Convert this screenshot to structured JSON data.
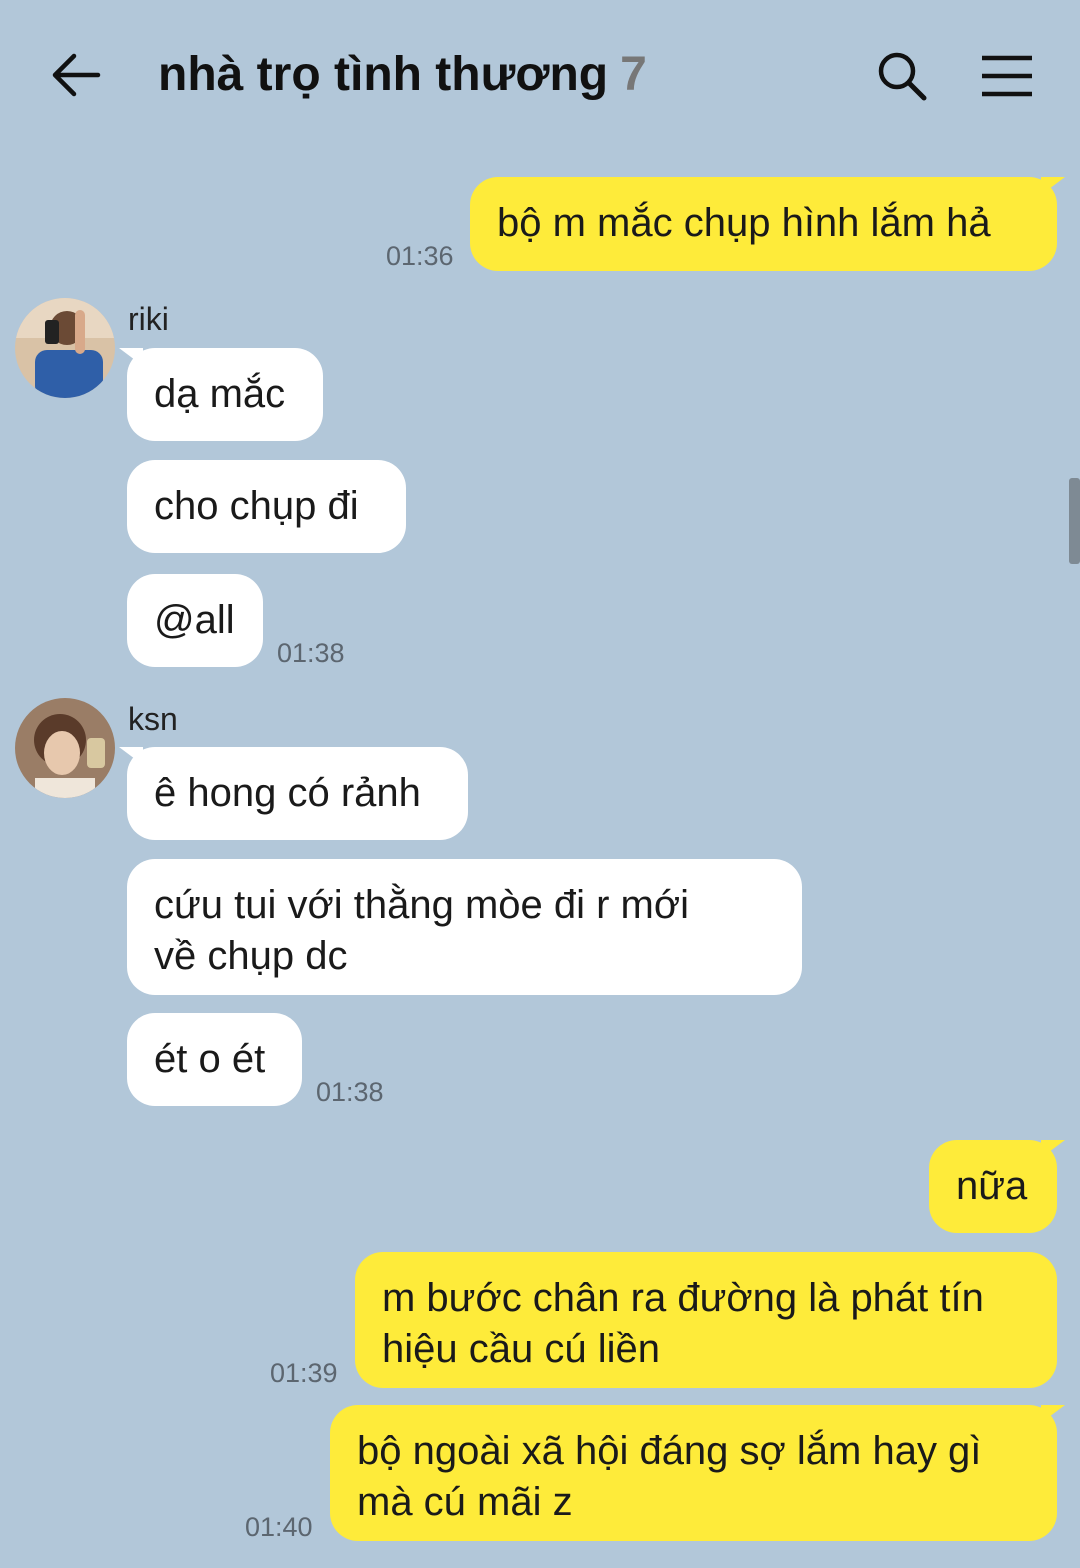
{
  "header": {
    "title": "nhà trọ tình thương",
    "member_count": "7",
    "icons": [
      "back-arrow-icon",
      "search-icon",
      "menu-icon"
    ]
  },
  "colors": {
    "background": "#b2c7d9",
    "outgoing_bubble": "#feeb3a",
    "incoming_bubble": "#ffffff"
  },
  "messages": [
    {
      "from": "me",
      "text": "bộ m mắc chụp hình lắm hả",
      "time": "01:36"
    },
    {
      "from": "riki",
      "sender_name": "riki",
      "text": "dạ mắc"
    },
    {
      "from": "riki",
      "text": "cho chụp đi"
    },
    {
      "from": "riki",
      "text": "@all",
      "time": "01:38"
    },
    {
      "from": "ksn",
      "sender_name": "ksn",
      "text": "ê hong có rảnh"
    },
    {
      "from": "ksn",
      "text_line1": "cứu tui với thằng mòe đi r mới",
      "text_line2": "về chụp dc"
    },
    {
      "from": "ksn",
      "text": "ét o ét",
      "time": "01:38"
    },
    {
      "from": "me",
      "text": "nữa"
    },
    {
      "from": "me",
      "text_line1": "m bước chân ra đường là phát tín",
      "text_line2": "hiệu cầu cú liền",
      "time": "01:39"
    },
    {
      "from": "me",
      "text_line1": "bộ ngoài xã hội đáng sợ lắm hay gì",
      "text_line2": "mà cú mãi z",
      "time": "01:40"
    }
  ]
}
